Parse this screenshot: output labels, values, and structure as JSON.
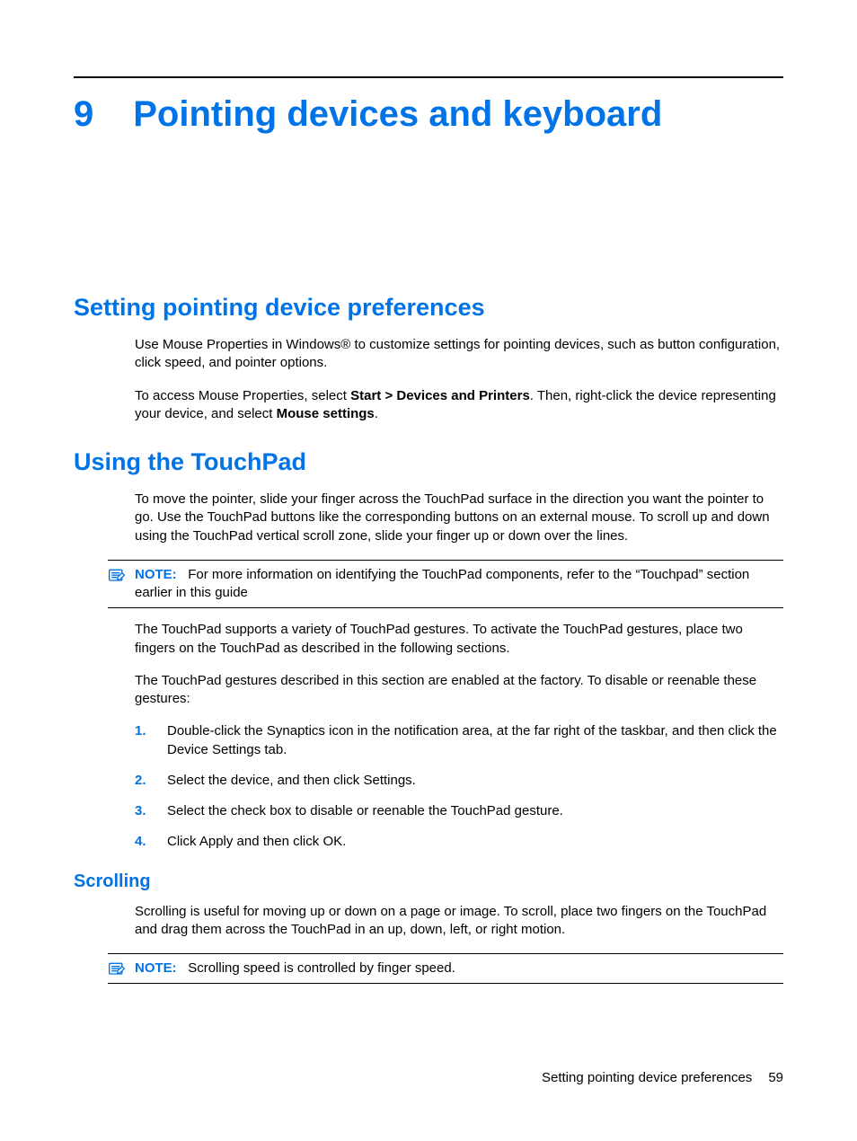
{
  "chapter": {
    "number": "9",
    "title": "Pointing devices and keyboard"
  },
  "sec1": {
    "heading": "Setting pointing device preferences",
    "p1": "Use Mouse Properties in Windows® to customize settings for pointing devices, such as button configuration, click speed, and pointer options.",
    "p2a": "To access Mouse Properties, select ",
    "p2b": "Start > Devices and Printers",
    "p2c": ". Then, right-click the device representing your device, and select ",
    "p2d": "Mouse settings",
    "p2e": "."
  },
  "sec2": {
    "heading": "Using the TouchPad",
    "p1": "To move the pointer, slide your finger across the TouchPad surface in the direction you want the pointer to go. Use the TouchPad buttons like the corresponding buttons on an external mouse. To scroll up and down using the TouchPad vertical scroll zone, slide your finger up or down over the lines.",
    "note1_label": "NOTE:",
    "note1_text": "For more information on identifying the TouchPad components, refer to the “Touchpad” section earlier in this guide",
    "p2": "The TouchPad supports a variety of TouchPad gestures. To activate the TouchPad gestures, place two fingers on the TouchPad as described in the following sections.",
    "p3": "The TouchPad gestures described in this section are enabled at the factory. To disable or reenable these gestures:",
    "steps": [
      {
        "n": "1.",
        "a": "Double-click the ",
        "b": "Synaptics",
        "c": " icon in the notification area, at the far right of the taskbar, and then click the ",
        "d": "Device Settings",
        "e": " tab."
      },
      {
        "n": "2.",
        "a": "Select the device, and then click ",
        "b": "Settings",
        "c": ".",
        "d": "",
        "e": ""
      },
      {
        "n": "3.",
        "a": "Select the check box to disable or reenable the TouchPad gesture.",
        "b": "",
        "c": "",
        "d": "",
        "e": ""
      },
      {
        "n": "4.",
        "a": "Click ",
        "b": "Apply",
        "c": " and then click ",
        "d": "OK",
        "e": "."
      }
    ],
    "sub": {
      "heading": "Scrolling",
      "p1": "Scrolling is useful for moving up or down on a page or image. To scroll, place two fingers on the TouchPad and drag them across the TouchPad in an up, down, left, or right motion.",
      "note_label": "NOTE:",
      "note_text": "Scrolling speed is controlled by finger speed."
    }
  },
  "footer": {
    "section": "Setting pointing device preferences",
    "page": "59"
  }
}
